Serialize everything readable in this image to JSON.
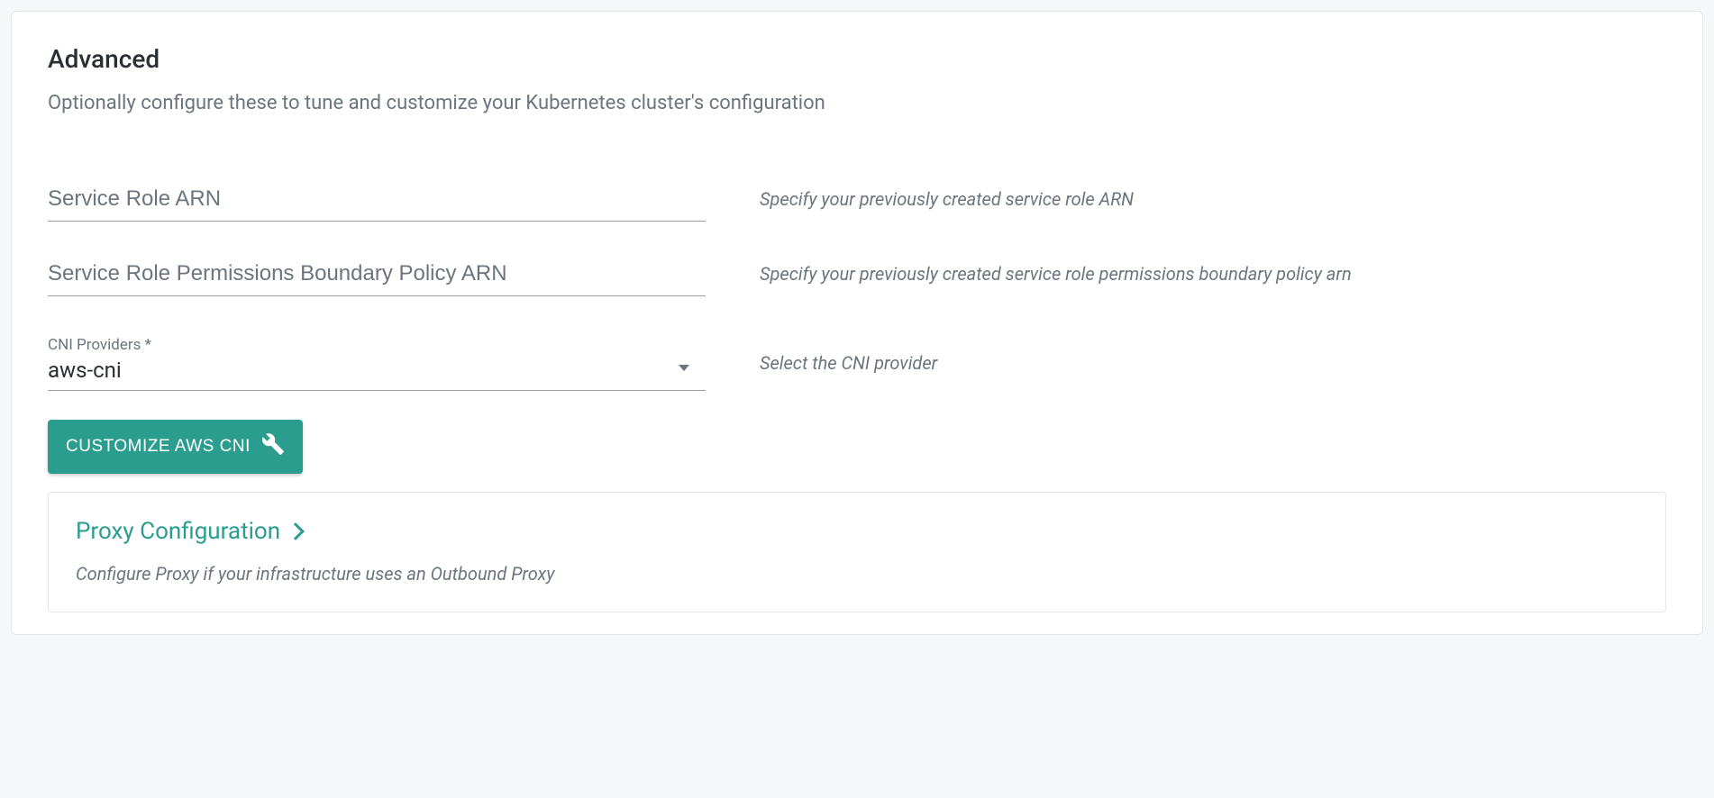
{
  "section": {
    "title": "Advanced",
    "subtitle": "Optionally configure these to tune and customize your Kubernetes cluster's configuration"
  },
  "fields": {
    "serviceRoleArn": {
      "placeholder": "Service Role ARN",
      "value": "",
      "helper": "Specify your previously created service role ARN"
    },
    "permissionsBoundaryArn": {
      "placeholder": "Service Role Permissions Boundary Policy ARN",
      "value": "",
      "helper": "Specify your previously created service role permissions boundary policy arn"
    },
    "cniProviders": {
      "label": "CNI Providers *",
      "value": "aws-cni",
      "helper": "Select the CNI provider"
    }
  },
  "buttons": {
    "customizeCni": "CUSTOMIZE AWS CNI"
  },
  "proxy": {
    "title": "Proxy Configuration",
    "description": "Configure Proxy if your infrastructure uses an Outbound Proxy"
  }
}
